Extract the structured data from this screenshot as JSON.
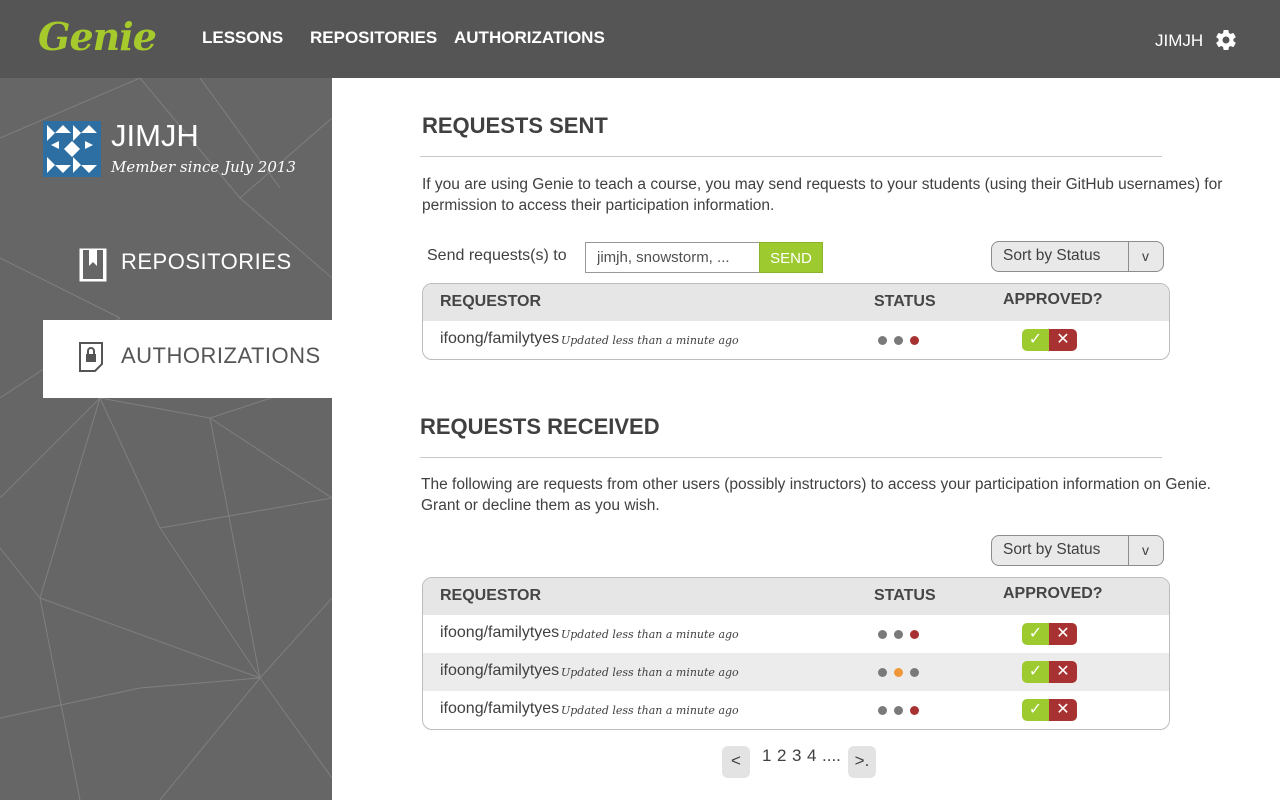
{
  "app": {
    "logo_text": "Genie",
    "nav": [
      "LESSONS",
      "REPOSITORIES",
      "AUTHORIZATIONS"
    ],
    "username": "JIMJH",
    "accent": "#9dca2e",
    "topbar_color": "#555555"
  },
  "profile": {
    "name": "JIMJH",
    "member_since": "Member since July 2013"
  },
  "sidebar": {
    "items": [
      {
        "label": "REPOSITORIES",
        "icon": "book-icon",
        "active": false
      },
      {
        "label": "AUTHORIZATIONS",
        "icon": "lock-document-icon",
        "active": true
      }
    ]
  },
  "sent": {
    "title": "REQUESTS SENT",
    "description_line1": "If you are using Genie to teach a course, you may send requests to your students (using their GitHub usernames) for",
    "description_line2": "permission to access their participation information.",
    "send_label": "Send requests(s) to",
    "input_value": "jimjh, snowstorm, ...",
    "send_button": "SEND",
    "sort_label": "Sort by Status",
    "sort_arrow": "v",
    "columns": [
      "REQUESTOR",
      "STATUS",
      "APPROVED?"
    ],
    "rows": [
      {
        "requestor": "ifoong/familytyes",
        "updated": "Updated less than a minute ago",
        "status": [
          "#7a7a7a",
          "#7a7a7a",
          "#a83232"
        ]
      }
    ]
  },
  "received": {
    "title": "REQUESTS RECEIVED",
    "description_line1": "The following are requests from other users (possibly instructors) to access your participation information on Genie.",
    "description_line2": "Grant or decline them as you wish.",
    "sort_label": "Sort by Status",
    "sort_arrow": "v",
    "columns": [
      "REQUESTOR",
      "STATUS",
      "APPROVED?"
    ],
    "rows": [
      {
        "requestor": "ifoong/familytyes",
        "updated": "Updated less than a minute ago",
        "status": [
          "#7a7a7a",
          "#7a7a7a",
          "#a83232"
        ]
      },
      {
        "requestor": "ifoong/familytyes",
        "updated": "Updated less than a minute ago",
        "status": [
          "#7a7a7a",
          "#f0973a",
          "#7a7a7a"
        ]
      },
      {
        "requestor": "ifoong/familytyes",
        "updated": "Updated less than a minute ago",
        "status": [
          "#7a7a7a",
          "#7a7a7a",
          "#a83232"
        ]
      }
    ]
  },
  "pagination": {
    "prev": "<",
    "pages": [
      "1",
      "2",
      "3",
      "4",
      "...."
    ],
    "next": ">."
  },
  "approve_symbol": "✓",
  "decline_symbol": "✕"
}
